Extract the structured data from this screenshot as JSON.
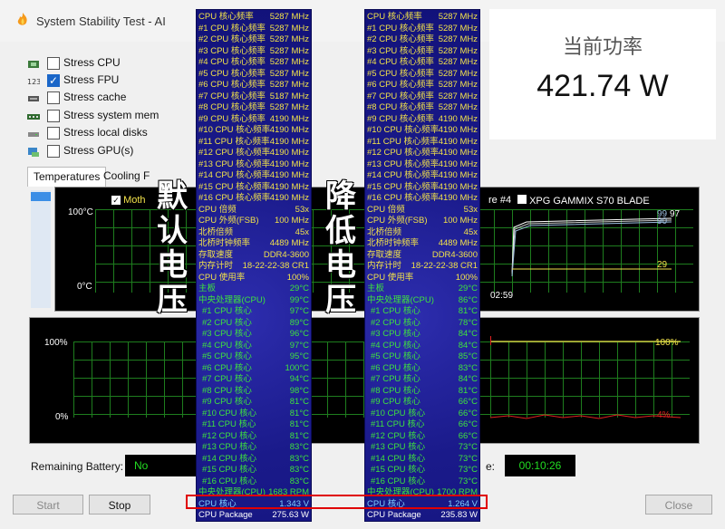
{
  "window": {
    "title": "System Stability Test - AI",
    "options": [
      {
        "label": "Stress CPU",
        "checked": false,
        "icon": "cpu-icon"
      },
      {
        "label": "Stress FPU",
        "checked": true,
        "icon": "fpu-icon"
      },
      {
        "label": "Stress cache",
        "checked": false,
        "icon": "cache-icon"
      },
      {
        "label": "Stress system mem",
        "checked": false,
        "icon": "memory-icon"
      },
      {
        "label": "Stress local disks",
        "checked": false,
        "icon": "disk-icon"
      },
      {
        "label": "Stress GPU(s)",
        "checked": false,
        "icon": "gpu-icon"
      }
    ],
    "tabs": [
      "Temperatures",
      "Cooling F"
    ],
    "chart_top": {
      "legend_left": "Moth",
      "legend_right_prefix": "re #4",
      "legend_right": "XPG GAMMIX S70 BLADE",
      "y_top": "100°C",
      "y_bottom": "0°C",
      "readings": [
        "99",
        "97",
        "90",
        "29"
      ],
      "time": "02:59"
    },
    "chart_bottom": {
      "y_top": "100%",
      "y_bottom": "0%",
      "right_top": "100%",
      "right_bottom": "4%"
    },
    "battery_label": "Remaining Battery:",
    "battery_value": "No",
    "elapsed_label": "e:",
    "elapsed_value": "00:10:26",
    "buttons": {
      "start": "Start",
      "stop": "Stop",
      "close": "Close"
    }
  },
  "labels": {
    "default_voltage": [
      "默",
      "认",
      "电",
      "压"
    ],
    "reduced_voltage": [
      "降",
      "低",
      "电",
      "压"
    ]
  },
  "power": {
    "title": "当前功率",
    "value": "421.74 W"
  },
  "panels": [
    {
      "rows": [
        {
          "k": "CPU 核心频率",
          "v": "5287 MHz",
          "c": "y"
        },
        {
          "k": "#1 CPU 核心频率",
          "v": "5287 MHz",
          "c": "y"
        },
        {
          "k": "#2 CPU 核心频率",
          "v": "5287 MHz",
          "c": "y"
        },
        {
          "k": "#3 CPU 核心频率",
          "v": "5287 MHz",
          "c": "y"
        },
        {
          "k": "#4 CPU 核心频率",
          "v": "5287 MHz",
          "c": "y"
        },
        {
          "k": "#5 CPU 核心频率",
          "v": "5287 MHz",
          "c": "y"
        },
        {
          "k": "#6 CPU 核心频率",
          "v": "5287 MHz",
          "c": "y"
        },
        {
          "k": "#7 CPU 核心频率",
          "v": "5187 MHz",
          "c": "y"
        },
        {
          "k": "#8 CPU 核心频率",
          "v": "5287 MHz",
          "c": "y"
        },
        {
          "k": "#9 CPU 核心频率",
          "v": "4190 MHz",
          "c": "y"
        },
        {
          "k": "#10 CPU 核心频率",
          "v": "4190 MHz",
          "c": "y"
        },
        {
          "k": "#11 CPU 核心频率",
          "v": "4190 MHz",
          "c": "y"
        },
        {
          "k": "#12 CPU 核心频率",
          "v": "4190 MHz",
          "c": "y"
        },
        {
          "k": "#13 CPU 核心频率",
          "v": "4190 MHz",
          "c": "y"
        },
        {
          "k": "#14 CPU 核心频率",
          "v": "4190 MHz",
          "c": "y"
        },
        {
          "k": "#15 CPU 核心频率",
          "v": "4190 MHz",
          "c": "y"
        },
        {
          "k": "#16 CPU 核心频率",
          "v": "4190 MHz",
          "c": "y"
        },
        {
          "k": "CPU 倍频",
          "v": "53x",
          "c": "y"
        },
        {
          "k": "CPU 外频(FSB)",
          "v": "100 MHz",
          "c": "y"
        },
        {
          "k": "北桥倍频",
          "v": "45x",
          "c": "y"
        },
        {
          "k": "北桥时钟频率",
          "v": "4489 MHz",
          "c": "y"
        },
        {
          "k": "存取速度",
          "v": "DDR4-3600",
          "c": "y"
        },
        {
          "k": "内存计时",
          "v": "18-22-22-38 CR1",
          "c": "y"
        },
        {
          "k": "CPU 使用率",
          "v": "100%",
          "c": "y"
        },
        {
          "k": "主板",
          "v": "29°C",
          "c": "g"
        },
        {
          "k": "中央处理器(CPU)",
          "v": "99°C",
          "c": "g"
        },
        {
          "k": "#1 CPU 核心",
          "v": "97°C",
          "c": "g",
          "ind": true
        },
        {
          "k": "#2 CPU 核心",
          "v": "89°C",
          "c": "g",
          "ind": true
        },
        {
          "k": "#3 CPU 核心",
          "v": "96°C",
          "c": "g",
          "ind": true
        },
        {
          "k": "#4 CPU 核心",
          "v": "97°C",
          "c": "g",
          "ind": true
        },
        {
          "k": "#5 CPU 核心",
          "v": "95°C",
          "c": "g",
          "ind": true
        },
        {
          "k": "#6 CPU 核心",
          "v": "100°C",
          "c": "g",
          "ind": true
        },
        {
          "k": "#7 CPU 核心",
          "v": "94°C",
          "c": "g",
          "ind": true
        },
        {
          "k": "#8 CPU 核心",
          "v": "98°C",
          "c": "g",
          "ind": true
        },
        {
          "k": "#9 CPU 核心",
          "v": "81°C",
          "c": "g",
          "ind": true
        },
        {
          "k": "#10 CPU 核心",
          "v": "81°C",
          "c": "g",
          "ind": true
        },
        {
          "k": "#11 CPU 核心",
          "v": "81°C",
          "c": "g",
          "ind": true
        },
        {
          "k": "#12 CPU 核心",
          "v": "81°C",
          "c": "g",
          "ind": true
        },
        {
          "k": "#13 CPU 核心",
          "v": "83°C",
          "c": "g",
          "ind": true
        },
        {
          "k": "#14 CPU 核心",
          "v": "83°C",
          "c": "g",
          "ind": true
        },
        {
          "k": "#15 CPU 核心",
          "v": "83°C",
          "c": "g",
          "ind": true
        },
        {
          "k": "#16 CPU 核心",
          "v": "83°C",
          "c": "g",
          "ind": true
        },
        {
          "k": "中央处理器(CPU)",
          "v": "1683 RPM",
          "c": "g"
        },
        {
          "k": "CPU 核心",
          "v": "1.343 V",
          "c": "c"
        },
        {
          "k": "CPU Package",
          "v": "275.63 W",
          "c": "w"
        }
      ]
    },
    {
      "rows": [
        {
          "k": "CPU 核心频率",
          "v": "5287 MHz",
          "c": "y"
        },
        {
          "k": "#1 CPU 核心频率",
          "v": "5287 MHz",
          "c": "y"
        },
        {
          "k": "#2 CPU 核心频率",
          "v": "5287 MHz",
          "c": "y"
        },
        {
          "k": "#3 CPU 核心频率",
          "v": "5287 MHz",
          "c": "y"
        },
        {
          "k": "#4 CPU 核心频率",
          "v": "5287 MHz",
          "c": "y"
        },
        {
          "k": "#5 CPU 核心频率",
          "v": "5287 MHz",
          "c": "y"
        },
        {
          "k": "#6 CPU 核心频率",
          "v": "5287 MHz",
          "c": "y"
        },
        {
          "k": "#7 CPU 核心频率",
          "v": "5287 MHz",
          "c": "y"
        },
        {
          "k": "#8 CPU 核心频率",
          "v": "5287 MHz",
          "c": "y"
        },
        {
          "k": "#9 CPU 核心频率",
          "v": "4190 MHz",
          "c": "y"
        },
        {
          "k": "#10 CPU 核心频率",
          "v": "4190 MHz",
          "c": "y"
        },
        {
          "k": "#11 CPU 核心频率",
          "v": "4190 MHz",
          "c": "y"
        },
        {
          "k": "#12 CPU 核心频率",
          "v": "4190 MHz",
          "c": "y"
        },
        {
          "k": "#13 CPU 核心频率",
          "v": "4190 MHz",
          "c": "y"
        },
        {
          "k": "#14 CPU 核心频率",
          "v": "4190 MHz",
          "c": "y"
        },
        {
          "k": "#15 CPU 核心频率",
          "v": "4190 MHz",
          "c": "y"
        },
        {
          "k": "#16 CPU 核心频率",
          "v": "4190 MHz",
          "c": "y"
        },
        {
          "k": "CPU 倍频",
          "v": "53x",
          "c": "y"
        },
        {
          "k": "CPU 外频(FSB)",
          "v": "100 MHz",
          "c": "y"
        },
        {
          "k": "北桥倍频",
          "v": "45x",
          "c": "y"
        },
        {
          "k": "北桥时钟频率",
          "v": "4489 MHz",
          "c": "y"
        },
        {
          "k": "存取速度",
          "v": "DDR4-3600",
          "c": "y"
        },
        {
          "k": "内存计时",
          "v": "18-22-22-38 CR1",
          "c": "y"
        },
        {
          "k": "CPU 使用率",
          "v": "100%",
          "c": "y"
        },
        {
          "k": "主板",
          "v": "29°C",
          "c": "g"
        },
        {
          "k": "中央处理器(CPU)",
          "v": "86°C",
          "c": "g"
        },
        {
          "k": "#1 CPU 核心",
          "v": "81°C",
          "c": "g",
          "ind": true
        },
        {
          "k": "#2 CPU 核心",
          "v": "78°C",
          "c": "g",
          "ind": true
        },
        {
          "k": "#3 CPU 核心",
          "v": "84°C",
          "c": "g",
          "ind": true
        },
        {
          "k": "#4 CPU 核心",
          "v": "84°C",
          "c": "g",
          "ind": true
        },
        {
          "k": "#5 CPU 核心",
          "v": "85°C",
          "c": "g",
          "ind": true
        },
        {
          "k": "#6 CPU 核心",
          "v": "83°C",
          "c": "g",
          "ind": true
        },
        {
          "k": "#7 CPU 核心",
          "v": "84°C",
          "c": "g",
          "ind": true
        },
        {
          "k": "#8 CPU 核心",
          "v": "81°C",
          "c": "g",
          "ind": true
        },
        {
          "k": "#9 CPU 核心",
          "v": "66°C",
          "c": "g",
          "ind": true
        },
        {
          "k": "#10 CPU 核心",
          "v": "66°C",
          "c": "g",
          "ind": true
        },
        {
          "k": "#11 CPU 核心",
          "v": "66°C",
          "c": "g",
          "ind": true
        },
        {
          "k": "#12 CPU 核心",
          "v": "66°C",
          "c": "g",
          "ind": true
        },
        {
          "k": "#13 CPU 核心",
          "v": "73°C",
          "c": "g",
          "ind": true
        },
        {
          "k": "#14 CPU 核心",
          "v": "73°C",
          "c": "g",
          "ind": true
        },
        {
          "k": "#15 CPU 核心",
          "v": "73°C",
          "c": "g",
          "ind": true
        },
        {
          "k": "#16 CPU 核心",
          "v": "73°C",
          "c": "g",
          "ind": true
        },
        {
          "k": "中央处理器(CPU)",
          "v": "1700 RPM",
          "c": "g"
        },
        {
          "k": "CPU 核心",
          "v": "1.264 V",
          "c": "c"
        },
        {
          "k": "CPU Package",
          "v": "235.83 W",
          "c": "w"
        }
      ]
    }
  ]
}
